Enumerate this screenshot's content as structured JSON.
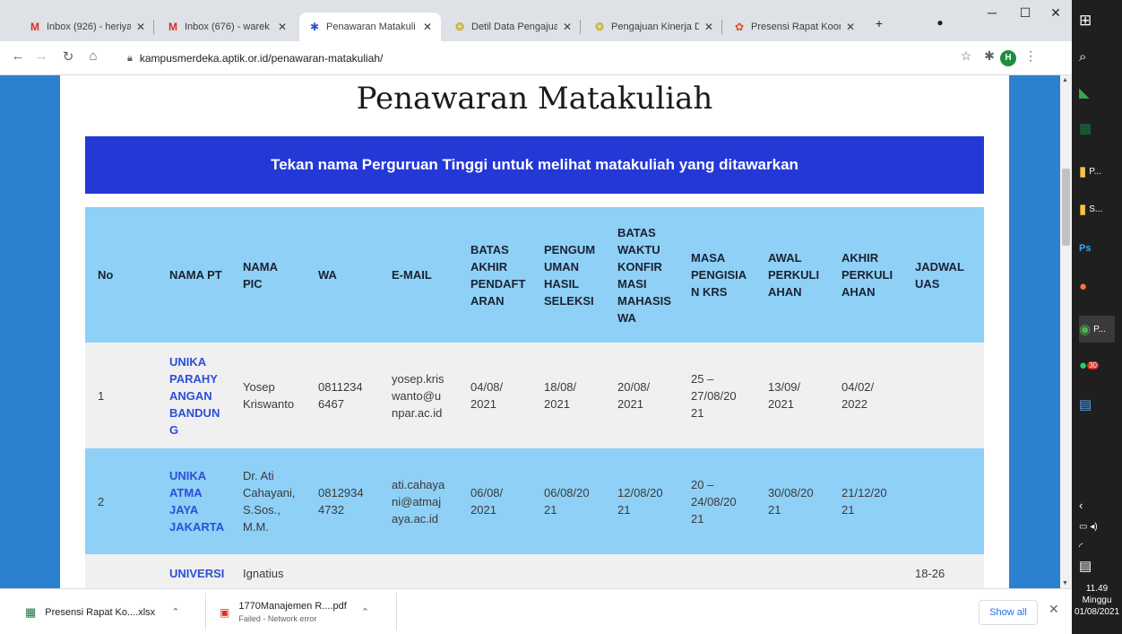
{
  "colors": {
    "banner": "#2438d6",
    "row_blue": "#8fd0f6",
    "row_gray": "#f0f0f0",
    "link": "#2b4fd8",
    "page_bg": "#2b81d0"
  },
  "tabs": [
    {
      "icon": "gmail-icon",
      "label": "Inbox (926) - heriyar"
    },
    {
      "icon": "gmail-icon",
      "label": "Inbox (676) - warek"
    },
    {
      "icon": "site-logo-icon",
      "label": "Penawaran Matakuli"
    },
    {
      "icon": "kemdikbud-icon",
      "label": "Detil Data Pengajua"
    },
    {
      "icon": "kemdikbud-icon",
      "label": "Pengajuan Kinerja D"
    },
    {
      "icon": "presensi-icon",
      "label": "Presensi Rapat Koor"
    }
  ],
  "address": {
    "url": "kampusmerdeka.aptik.or.id/penawaran-matakuliah/"
  },
  "page": {
    "title": "Penawaran Matakuliah",
    "banner": "Tekan nama Perguruan Tinggi untuk melihat matakuliah yang ditawarkan"
  },
  "table": {
    "headers": [
      "No",
      "NAMA PT",
      "NAMA\nPIC",
      "WA",
      "E-MAIL",
      "BATAS\nAKHIR\nPENDAFT\nARAN",
      "PENGUM\nUMAN\nHASIL\nSELEKSI",
      "BATAS\nWAKTU\nKONFIR\nMASI\nMAHASIS\nWA",
      "MASA\nPENGISIA\nN KRS",
      "AWAL\nPERKULI\nAHAN",
      "AKHIR\nPERKULI\nAHAN",
      "JADWAL\nUAS"
    ],
    "rows": [
      [
        "1",
        "UNIKA\nPARAHY\nANGAN\nBANDUN\nG",
        "Yosep\nKriswanto",
        "0811234\n6467",
        "yosep.kris\nwanto@u\nnpar.ac.id",
        "04/08/\n2021",
        "18/08/\n2021",
        "20/08/\n2021",
        "25 –\n27/08/20\n21",
        "13/09/\n2021",
        "04/02/\n2022",
        ""
      ],
      [
        "2",
        "UNIKA\nATMA\nJAYA\nJAKARTA",
        "Dr. Ati\nCahayani,\nS.Sos.,\nM.M.",
        "0812934\n4732",
        "ati.cahaya\nni@atmaj\naya.ac.id",
        "06/08/\n2021",
        "06/08/20\n21",
        "12/08/20\n21",
        "20 –\n24/08/20\n21",
        "30/08/20\n21",
        "21/12/20\n21",
        ""
      ],
      [
        "",
        "UNIVERSI",
        "Ignatius",
        "",
        "",
        "",
        "",
        "",
        "",
        "",
        "",
        "18-26"
      ]
    ]
  },
  "downloads": [
    {
      "name": "Presensi Rapat Ko....xlsx",
      "status": ""
    },
    {
      "name": "1770Manajemen R....pdf",
      "status": "Failed - Network error"
    }
  ],
  "show_all": "Show all",
  "clock": {
    "time": "11.49",
    "day": "Minggu",
    "date": "01/08/2021"
  },
  "taskbar_labels": {
    "app_p1": "P...",
    "app_s": "S...",
    "app_chrome": "P...",
    "whatsapp_badge": "30"
  }
}
